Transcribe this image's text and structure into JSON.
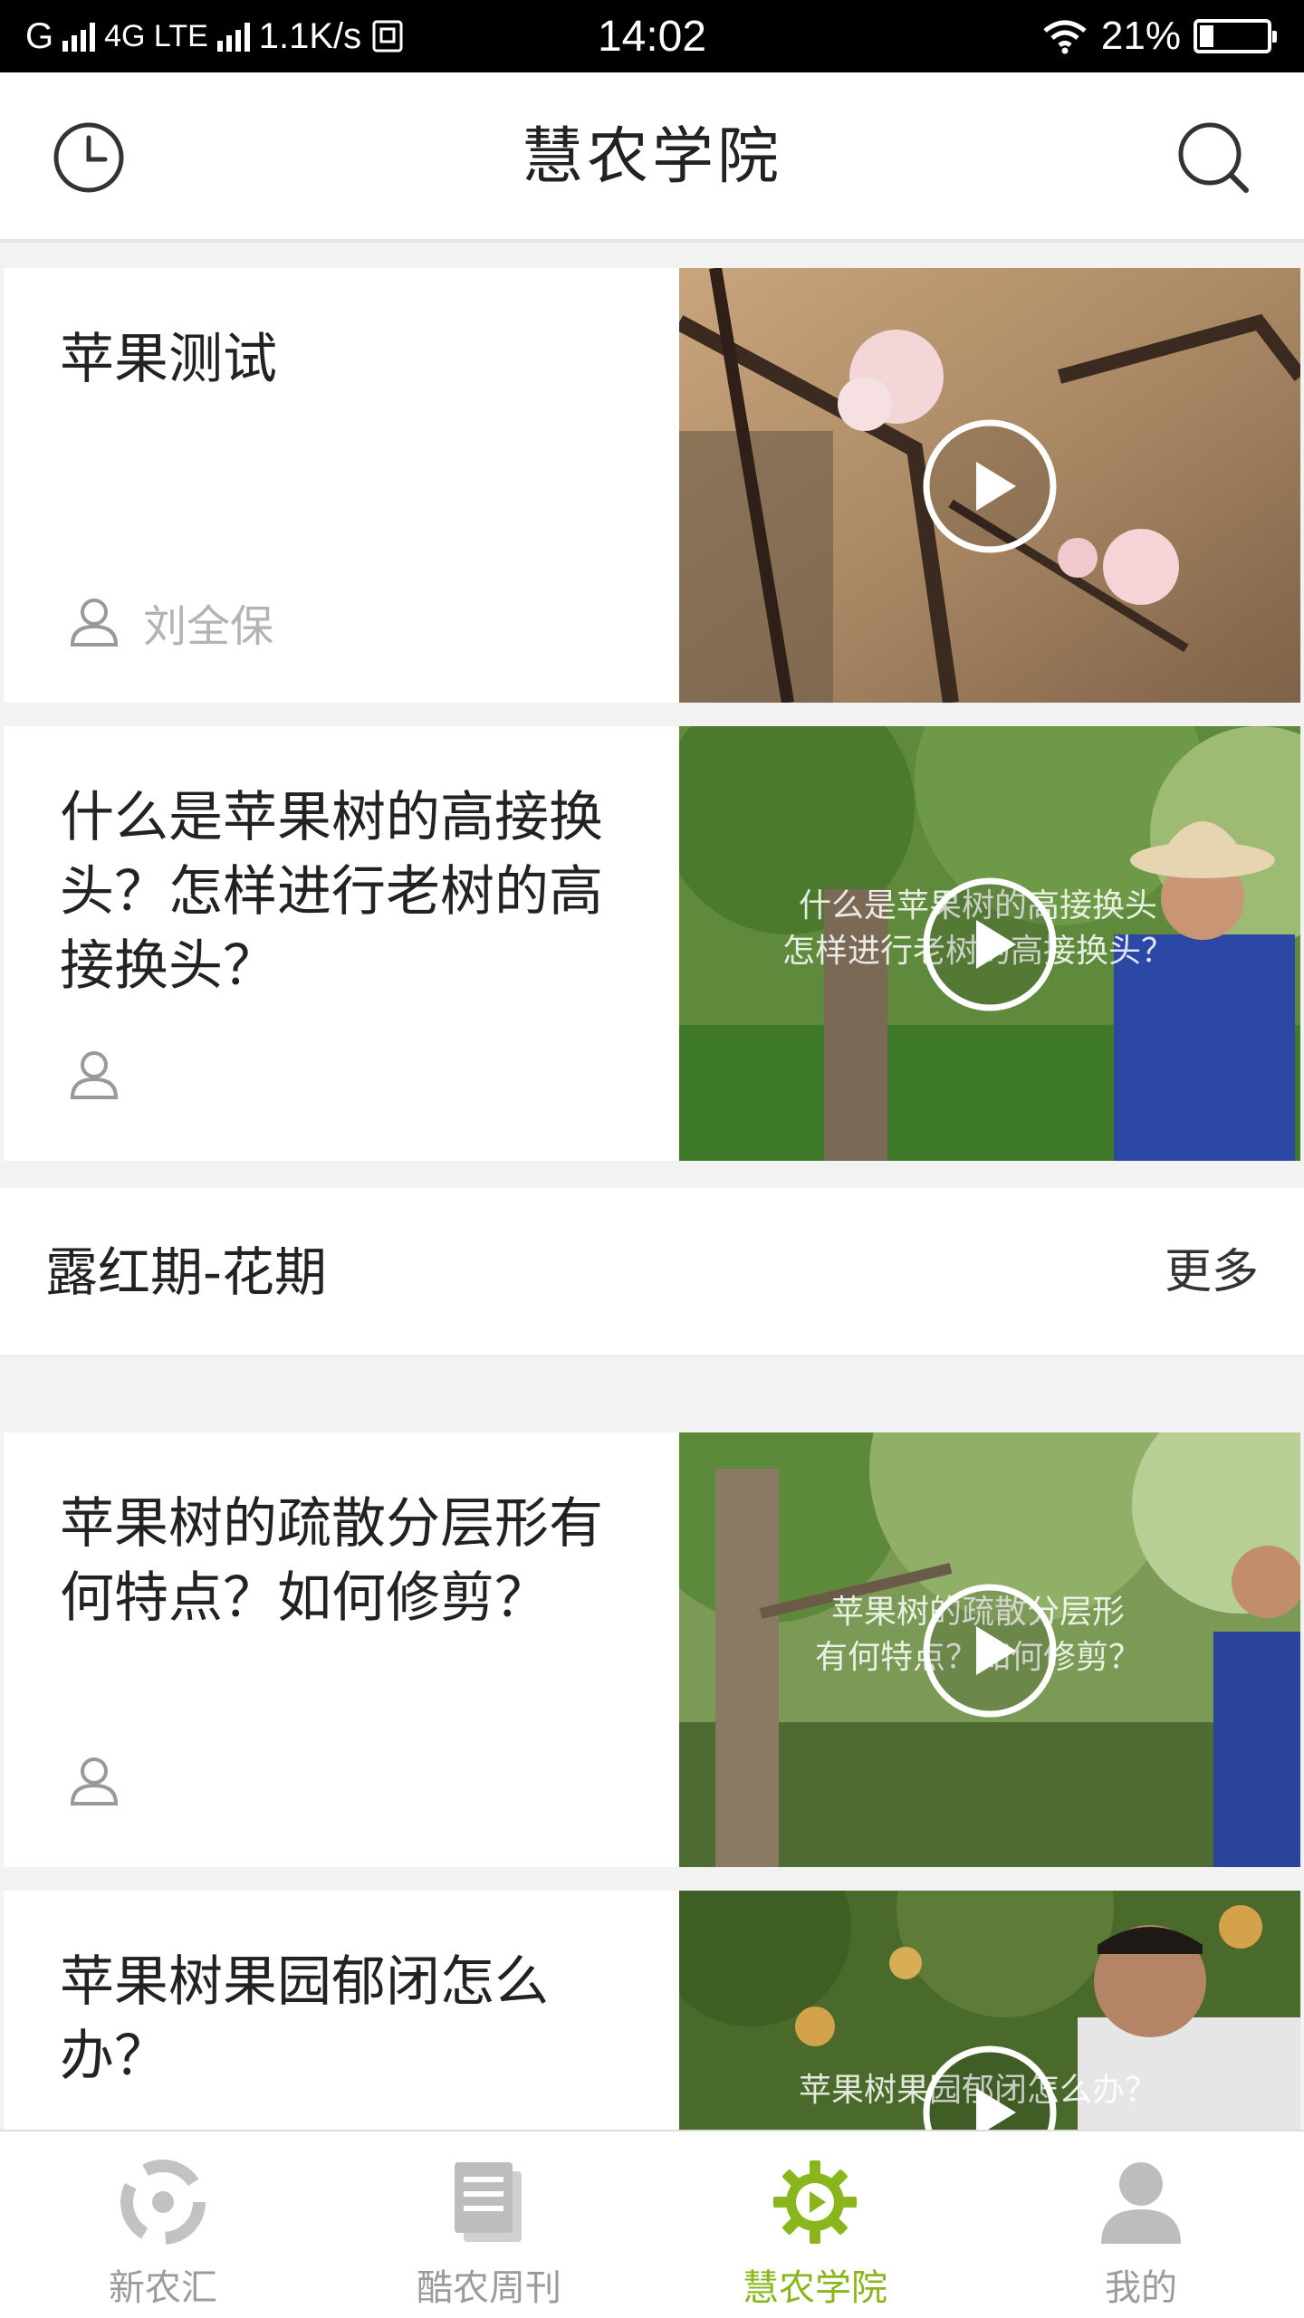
{
  "status_bar": {
    "left": "G",
    "network": "4G LTE",
    "speed": "1.1K/s",
    "time": "14:02",
    "battery": "21%",
    "battery_level": 0.21
  },
  "header": {
    "title": "慧农学院",
    "history_icon": "clock-icon",
    "search_icon": "search-icon"
  },
  "cards": [
    {
      "title": "苹果测试",
      "author": "刘全保",
      "caption": []
    },
    {
      "title": "什么是苹果树的高接换头？怎样进行老树的高接换头？",
      "author": "",
      "caption": [
        "什么是苹果树的高接换头",
        "怎样进行老树的高接换头？"
      ]
    },
    {
      "title": "苹果树的疏散分层形有何特点？如何修剪？",
      "author": "",
      "caption": [
        "苹果树的疏散分层形",
        "有何特点？如何修剪？"
      ]
    },
    {
      "title": "苹果树果园郁闭怎么办？",
      "author": "",
      "caption": [
        "苹果树果园郁闭怎么办？"
      ]
    }
  ],
  "section": {
    "title": "露红期-花期",
    "more": "更多"
  },
  "bottom_nav": {
    "items": [
      {
        "label": "新农汇",
        "icon": "community-icon"
      },
      {
        "label": "酷农周刊",
        "icon": "magazine-icon"
      },
      {
        "label": "慧农学院",
        "icon": "academy-gear-icon",
        "active": true
      },
      {
        "label": "我的",
        "icon": "profile-icon"
      }
    ]
  },
  "colors": {
    "accent": "#8ab61d",
    "inactive": "#9b9b9b",
    "background": "#f2f2f2"
  }
}
